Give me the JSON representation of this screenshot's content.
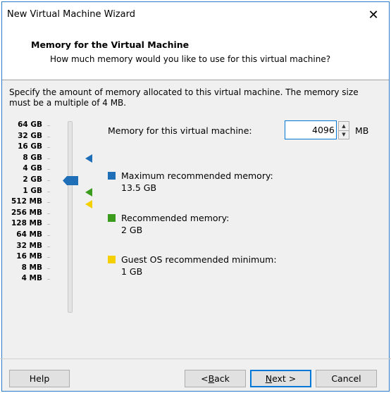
{
  "window": {
    "title": "New Virtual Machine Wizard",
    "close_glyph": "✕"
  },
  "header": {
    "title": "Memory for the Virtual Machine",
    "subtitle": "How much memory would you like to use for this virtual machine?"
  },
  "description": "Specify the amount of memory allocated to this virtual machine. The memory size must be a multiple of 4 MB.",
  "scale": [
    "64 GB",
    "32 GB",
    "16 GB",
    "8 GB",
    "4 GB",
    "2 GB",
    "1 GB",
    "512 MB",
    "256 MB",
    "128 MB",
    "64 MB",
    "32 MB",
    "16 MB",
    "8 MB",
    "4 MB"
  ],
  "slider": {
    "selected_label": "4 GB"
  },
  "memory": {
    "label": "Memory for this virtual machine:",
    "value": "4096",
    "unit": "MB"
  },
  "legend": [
    {
      "label": "Maximum recommended memory:",
      "value": "13.5 GB",
      "color": "#1e6fb8",
      "marker_at": "16 GB"
    },
    {
      "label": "Recommended memory:",
      "value": "2 GB",
      "color": "#3b9b1c",
      "marker_at": "2 GB"
    },
    {
      "label": "Guest OS recommended minimum:",
      "value": "1 GB",
      "color": "#f5d000",
      "marker_at": "1 GB"
    }
  ],
  "buttons": {
    "help": "Help",
    "back": "< Back",
    "next": "Next >",
    "cancel": "Cancel"
  }
}
